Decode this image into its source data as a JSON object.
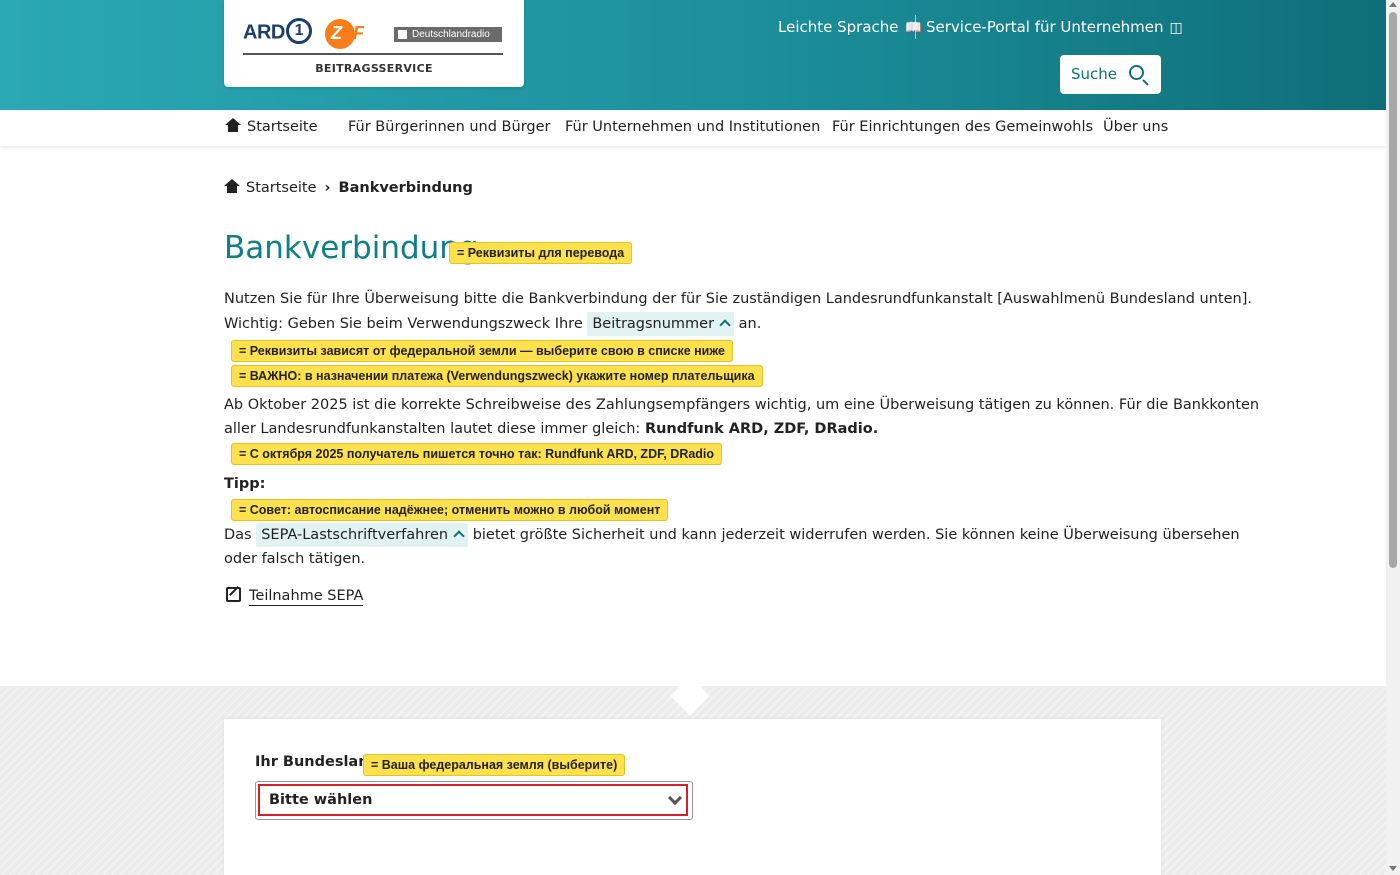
{
  "header": {
    "logo_ard": "ARD",
    "logo_ard_number": "1",
    "logo_zdf_z": "Z",
    "logo_zdf_rest": "DF",
    "logo_dlr": "Deutschlandradio",
    "logo_sub": "BEITRAGSSERVICE",
    "link_easy": "Leichte Sprache",
    "link_portal": "Service-Portal für Unternehmen",
    "search_label": "Suche"
  },
  "nav": {
    "items": [
      {
        "label": "Startseite"
      },
      {
        "label": "Für Bürgerinnen und Bürger"
      },
      {
        "label": "Für Unternehmen und Institutionen"
      },
      {
        "label": "Für Einrichtungen des Gemeinwohls"
      },
      {
        "label": "Über uns"
      }
    ]
  },
  "breadcrumb": {
    "home": "Startseite",
    "current": "Bankverbindung"
  },
  "page": {
    "title": "Bankverbindung",
    "p1_line1": "Nutzen Sie für Ihre Überweisung bitte die Bankverbindung der für Sie zuständigen Landesrundfunkanstalt [Auswahlmenü Bundesland unten].",
    "p1_line2_pre": "Wichtig: Geben Sie beim Verwendungszweck Ihre",
    "p1_chip": "Beitragsnummer",
    "p1_line2_post": "an.",
    "p2_line1": "Ab Oktober 2025 ist die korrekte Schreibweise des Zahlungsempfängers wichtig, um eine Überweisung tätigen zu können. Für die Bankkonten",
    "p2_line2_pre": "aller Landesrundfunkanstalten lautet diese immer gleich:",
    "p2_line2_bold": "Rundfunk ARD, ZDF, DRadio.",
    "tip_label": "Tipp:",
    "p3_line1_pre": "Das",
    "p3_chip": "SEPA-Lastschriftverfahren",
    "p3_line1_post": "bietet größte Sicherheit und kann jederzeit widerrufen werden. Sie können keine Überweisung übersehen",
    "p3_line2": "oder falsch tätigen.",
    "sepa_link": "Teilnahme SEPA"
  },
  "annotations": {
    "title": "= Реквизиты для перевода",
    "a1": "= Реквизиты зависят от федеральной земли — выберите свою в списке ниже",
    "a2": "= ВАЖНО: в назначении платежа (Verwendungszweck) укажите номер плательщика",
    "a3": "= С октября 2025 получатель пишется точно так: Rundfunk ARD, ZDF, DRadio",
    "a4": "= Совет: автосписание надёжнее; отменить можно в любой момент",
    "a5": "= Ваша федеральная земля (выберите)"
  },
  "form": {
    "label": "Ihr Bundesland",
    "select_value": "Bitte wählen"
  },
  "colors": {
    "accent": "#0f7f87",
    "header_gradient_start": "#2aa8b4",
    "header_gradient_end": "#0f6e78",
    "annotation_bg": "#ffe04d",
    "select_border": "#d8202a"
  }
}
